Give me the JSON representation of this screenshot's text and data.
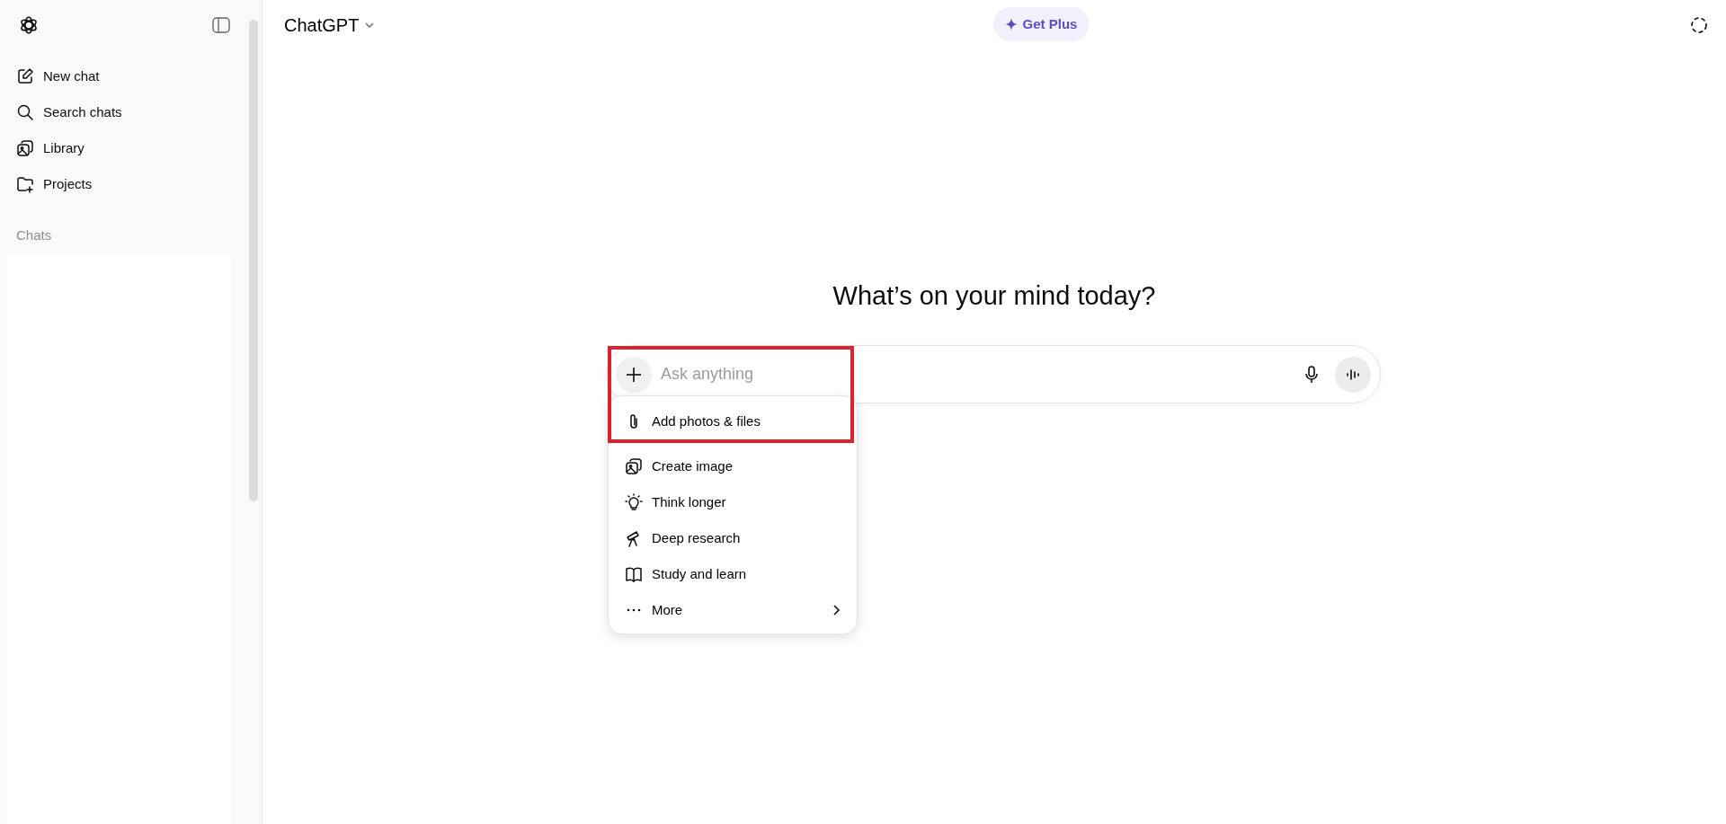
{
  "sidebar": {
    "items": [
      {
        "label": "New chat",
        "kind": "compose"
      },
      {
        "label": "Search chats",
        "kind": "search"
      },
      {
        "label": "Library",
        "kind": "images"
      },
      {
        "label": "Projects",
        "kind": "folder"
      }
    ],
    "section_label": "Chats"
  },
  "header": {
    "title": "ChatGPT",
    "upgrade_button": "Get Plus"
  },
  "heading": "What’s on your mind today?",
  "composer": {
    "placeholder": "Ask anything"
  },
  "attach_menu": {
    "items": [
      {
        "label": "Add photos & files",
        "kind": "clip",
        "submenu": false
      },
      {
        "label": "Create image",
        "kind": "images",
        "submenu": false
      },
      {
        "label": "Think longer",
        "kind": "bulb",
        "submenu": false
      },
      {
        "label": "Deep research",
        "kind": "telescope",
        "submenu": false
      },
      {
        "label": "Study and learn",
        "kind": "book",
        "submenu": false
      },
      {
        "label": "More",
        "kind": "dots",
        "submenu": true
      }
    ]
  }
}
